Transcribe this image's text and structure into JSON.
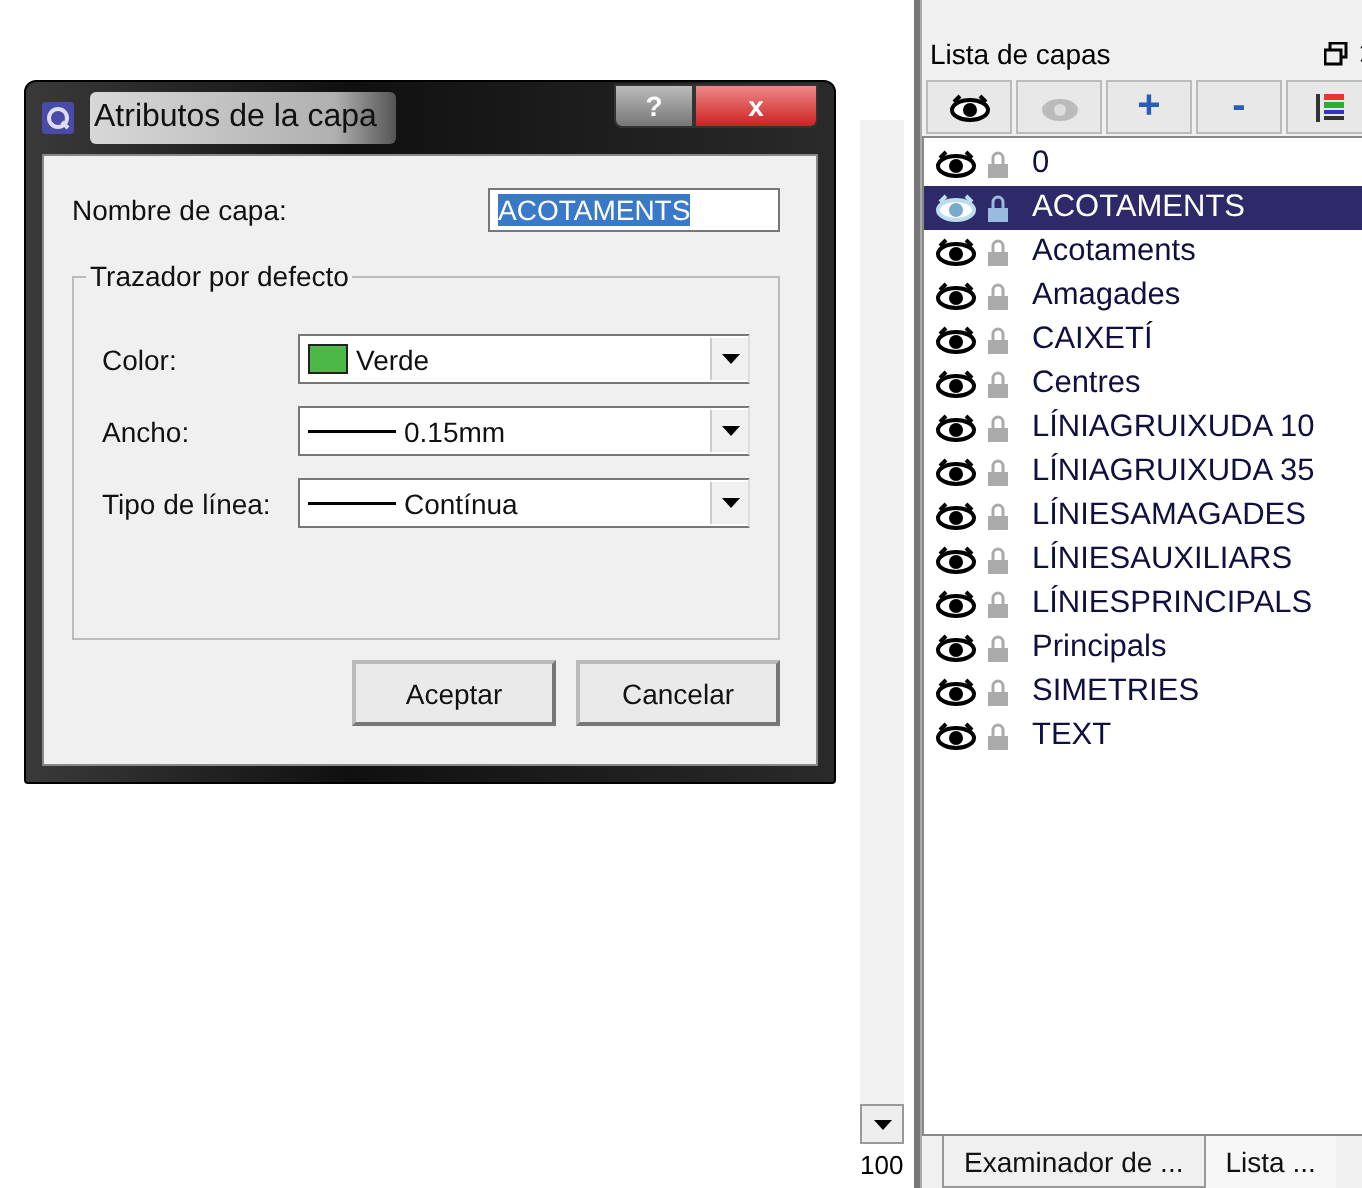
{
  "dialog": {
    "title": "Atributos de la capa",
    "help_button": "?",
    "close_button": "x",
    "name_label": "Nombre de capa:",
    "name_value": "ACOTAMENTS",
    "group_label": "Trazador por defecto",
    "fields": [
      {
        "kind": "color",
        "label": "Color:",
        "value": "Verde",
        "color": "#4cb848"
      },
      {
        "kind": "line",
        "label": "Ancho:",
        "value": "0.15mm"
      },
      {
        "kind": "line",
        "label": "Tipo de línea:",
        "value": "Contínua"
      }
    ],
    "buttons": [
      "Aceptar",
      "Cancelar"
    ]
  },
  "zoom_value": "100",
  "layer_panel": {
    "title": "Lista de capas",
    "toolbar": [
      {
        "kind": "eye"
      },
      {
        "kind": "eye-off"
      },
      {
        "kind": "text",
        "label": "+"
      },
      {
        "kind": "text",
        "label": "-"
      },
      {
        "kind": "list"
      }
    ],
    "layers": [
      {
        "name": "0",
        "selected": false
      },
      {
        "name": "ACOTAMENTS",
        "selected": true
      },
      {
        "name": "Acotaments",
        "selected": false
      },
      {
        "name": "Amagades",
        "selected": false
      },
      {
        "name": "CAIXETÍ",
        "selected": false
      },
      {
        "name": "Centres",
        "selected": false
      },
      {
        "name": "LÍNIAGRUIXUDA 10",
        "selected": false
      },
      {
        "name": "LÍNIAGRUIXUDA 35",
        "selected": false
      },
      {
        "name": "LÍNIESAMAGADES",
        "selected": false
      },
      {
        "name": "LÍNIESAUXILIARS",
        "selected": false
      },
      {
        "name": "LÍNIESPRINCIPALS",
        "selected": false
      },
      {
        "name": "Principals",
        "selected": false
      },
      {
        "name": "SIMETRIES",
        "selected": false
      },
      {
        "name": "TEXT",
        "selected": false
      }
    ],
    "tabs": [
      {
        "label": "Examinador de ...",
        "selected": false
      },
      {
        "label": "Lista ...",
        "selected": true
      }
    ]
  }
}
